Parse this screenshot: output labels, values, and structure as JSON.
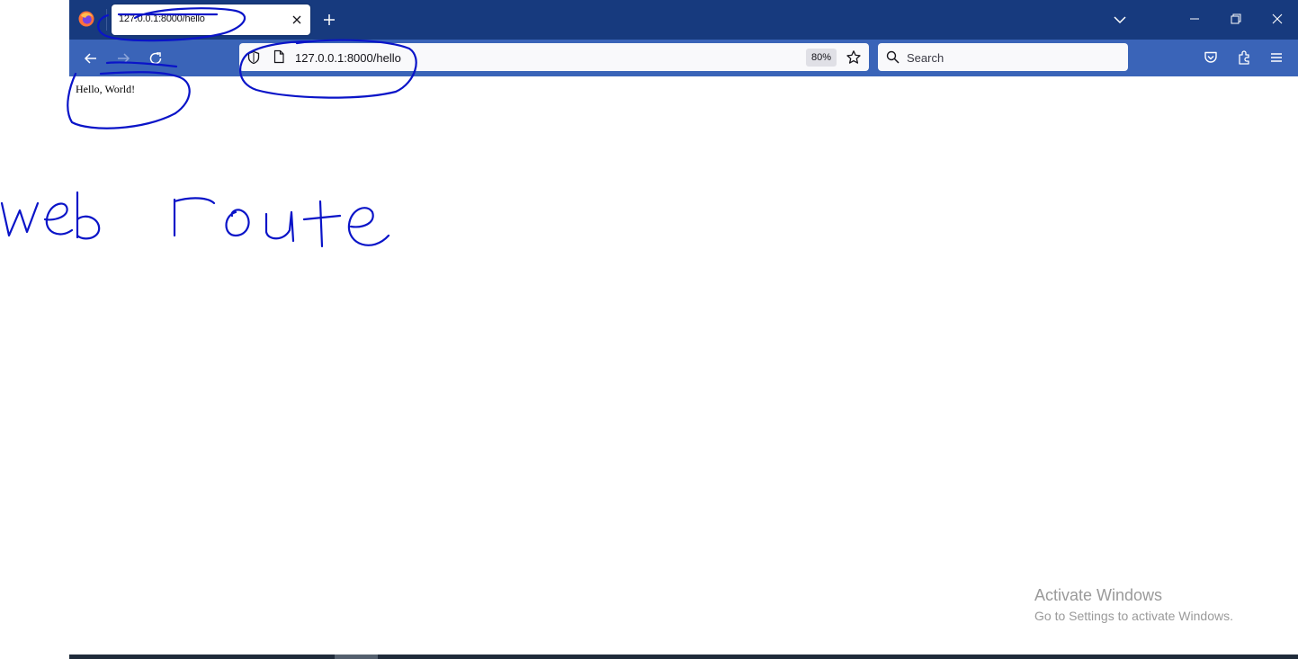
{
  "browser": {
    "tab": {
      "title": "127.0.0.1:8000/hello"
    },
    "url": "127.0.0.1:8000/hello",
    "zoom": "80%",
    "search": {
      "placeholder": "Search"
    }
  },
  "page": {
    "text": "Hello, World!"
  },
  "annotation": {
    "handwritten_text": "web route"
  },
  "watermark": {
    "title": "Activate Windows",
    "subtitle": "Go to Settings to activate Windows."
  },
  "colors": {
    "tabstrip": "#173a7e",
    "toolbar": "#3a64b8",
    "ink": "#0a14c8"
  },
  "icons": [
    "firefox-icon",
    "close-icon",
    "plus-icon",
    "chevron-down-icon",
    "minimize-icon",
    "restore-icon",
    "window-close-icon",
    "back-arrow-icon",
    "forward-arrow-icon",
    "reload-icon",
    "shield-icon",
    "page-icon",
    "star-icon",
    "search-icon",
    "pocket-icon",
    "extensions-icon",
    "menu-icon"
  ]
}
